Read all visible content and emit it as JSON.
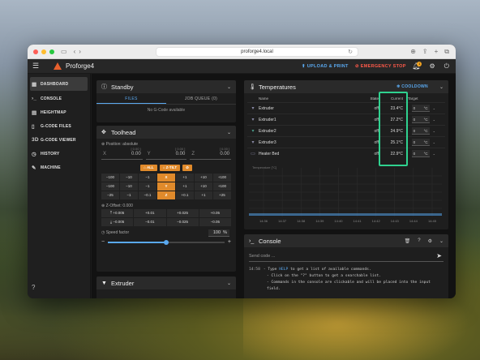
{
  "browser": {
    "url": "proforge4.local"
  },
  "app": {
    "brand": "Proforge4",
    "upload_label": "UPLOAD & PRINT",
    "estop_label": "EMERGENCY STOP",
    "notification_count": "1"
  },
  "sidebar": {
    "items": [
      {
        "label": "DASHBOARD",
        "icon": "dashboard-icon",
        "active": true
      },
      {
        "label": "CONSOLE",
        "icon": "console-icon"
      },
      {
        "label": "HEIGHTMAP",
        "icon": "heightmap-icon"
      },
      {
        "label": "G-CODE FILES",
        "icon": "file-icon"
      },
      {
        "label": "G-CODE VIEWER",
        "icon": "viewer-icon"
      },
      {
        "label": "HISTORY",
        "icon": "history-icon"
      },
      {
        "label": "MACHINE",
        "icon": "wrench-icon"
      }
    ]
  },
  "standby": {
    "title": "Standby",
    "tabs": [
      "FILES",
      "JOB QUEUE (0)"
    ],
    "empty": "No G-Code available"
  },
  "toolhead": {
    "title": "Toolhead",
    "position_label": "Position: absolute",
    "axes": [
      {
        "label": "X",
        "value": "0.00",
        "sub": "[ 0.00 ]"
      },
      {
        "label": "Y",
        "value": "0.00",
        "sub": "[ 0.00 ]"
      },
      {
        "label": "Z",
        "value": "0.00",
        "sub": "[ 0.00 ]"
      }
    ],
    "home_buttons": [
      "ALL",
      "Z-TILT"
    ],
    "jog_rows": [
      [
        "−100",
        "−10",
        "−1",
        "X",
        "+1",
        "+10",
        "+100"
      ],
      [
        "−100",
        "−10",
        "−1",
        "Y",
        "+1",
        "+10",
        "+100"
      ],
      [
        "−25",
        "−1",
        "−0.1",
        "Z",
        "+0.1",
        "+1",
        "+25"
      ]
    ],
    "zoffset_label": "Z-Offset: 0.000",
    "zoffset_rows": [
      [
        "+0.005",
        "+0.01",
        "+0.025",
        "+0.05"
      ],
      [
        "−0.005",
        "−0.01",
        "−0.025",
        "−0.05"
      ]
    ],
    "speed_label": "Speed factor",
    "speed_value": "100",
    "speed_unit": "%",
    "speed_fraction": 0.5
  },
  "extruder_card": {
    "title": "Extruder"
  },
  "temperatures": {
    "title": "Temperatures",
    "cooldown_label": "COOLDOWN",
    "headers": {
      "name": "Name",
      "state": "State",
      "current": "Current",
      "target": "Target"
    },
    "rows": [
      {
        "name": "Extruder",
        "state": "off",
        "current": "23.4°C",
        "target": "0",
        "unit": "°C"
      },
      {
        "name": "Extruder1",
        "state": "off",
        "current": "27.2°C",
        "target": "0",
        "unit": "°C"
      },
      {
        "name": "Extruder2",
        "state": "off",
        "current": "24.9°C",
        "target": "0",
        "unit": "°C"
      },
      {
        "name": "Extruder3",
        "state": "off",
        "current": "25.1°C",
        "target": "0",
        "unit": "°C"
      },
      {
        "name": "Heater Bed",
        "state": "off",
        "current": "22.9°C",
        "target": "0",
        "unit": "°C"
      }
    ],
    "chart_label": "Temperature [°C]",
    "chart_ticks": [
      "14:36",
      "14:37",
      "14:38",
      "14:39",
      "14:40",
      "14:41",
      "14:42",
      "14:43",
      "14:44",
      "14:45"
    ],
    "highlight_color": "#2fd18f"
  },
  "console": {
    "title": "Console",
    "placeholder": "Send code ...",
    "time": "14:58",
    "lines": [
      {
        "pre": "- Type ",
        "kw": "HELP",
        "post": " to get a list of available commands."
      },
      {
        "text": "- Click on the \"?\" button to get a searchable list."
      },
      {
        "text": "- Commands in the console are clickable and will be placed into the input"
      },
      {
        "text": "field."
      }
    ]
  }
}
